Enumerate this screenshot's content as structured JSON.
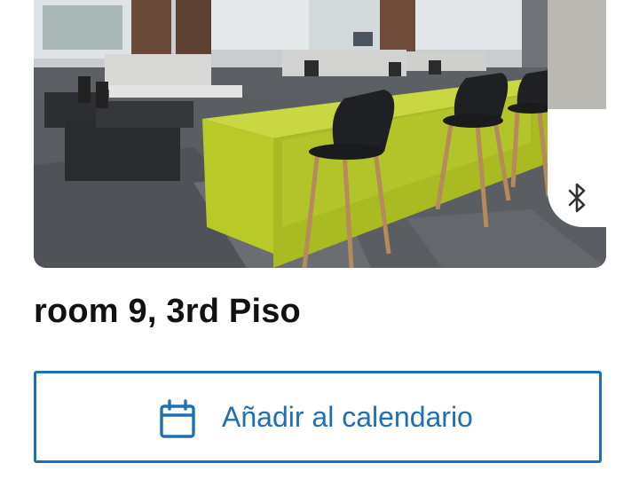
{
  "room": {
    "title": "room 9, 3rd Piso",
    "photo_icon": "office-photo"
  },
  "bluetooth": {
    "icon": "bluetooth-icon"
  },
  "calendar_button": {
    "label": "Añadir al calendario",
    "icon": "calendar-icon"
  },
  "colors": {
    "accent": "#1f6fb2",
    "title_text": "#111111",
    "background": "#ffffff"
  }
}
